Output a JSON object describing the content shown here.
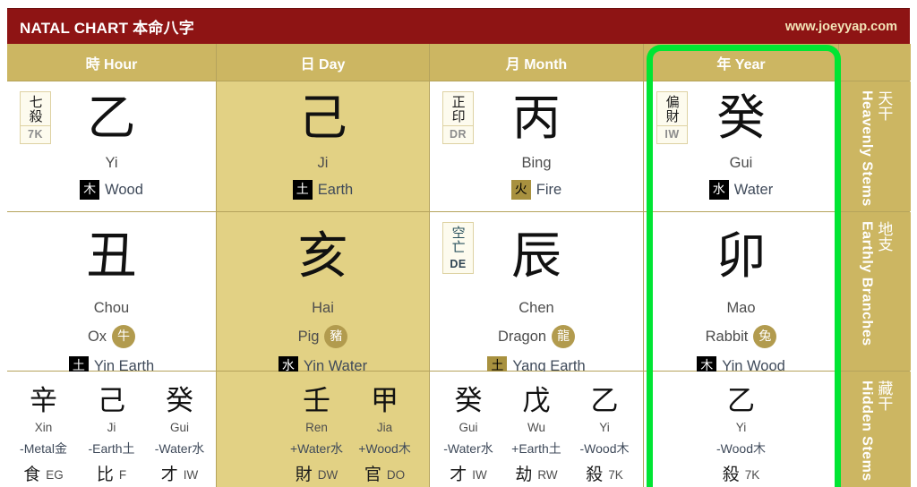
{
  "header": {
    "title": "NATAL CHART 本命八字",
    "website": "www.joeyyap.com",
    "bar_color": "#8e1414",
    "accent_color": "#ccb662",
    "highlight_color": "#00e533"
  },
  "columns": [
    {
      "key": "hour",
      "label": "時 Hour",
      "highlighted": false,
      "day_master": false
    },
    {
      "key": "day",
      "label": "日 Day",
      "highlighted": false,
      "day_master": true
    },
    {
      "key": "month",
      "label": "月 Month",
      "highlighted": false,
      "day_master": false
    },
    {
      "key": "year",
      "label": "年 Year",
      "highlighted": true,
      "day_master": false
    }
  ],
  "row_labels": [
    {
      "cn": "天干",
      "en": "Heavenly Stems"
    },
    {
      "cn": "地支",
      "en": "Earthly Branches"
    },
    {
      "cn": "藏干",
      "en": "Hidden Stems"
    }
  ],
  "heavenly_stems": {
    "hour": {
      "badge_cn": "七殺",
      "badge_ab": "7K",
      "badge_style": "gray",
      "char": "乙",
      "romanization": "Yi",
      "element_cn": "木",
      "element_en": "Wood",
      "element_badge_style": "black"
    },
    "day": {
      "badge_cn": "",
      "badge_ab": "",
      "badge_style": "none",
      "char": "己",
      "romanization": "Ji",
      "element_cn": "土",
      "element_en": "Earth",
      "element_badge_style": "black"
    },
    "month": {
      "badge_cn": "正印",
      "badge_ab": "DR",
      "badge_style": "gray",
      "char": "丙",
      "romanization": "Bing",
      "element_cn": "火",
      "element_en": "Fire",
      "element_badge_style": "gold"
    },
    "year": {
      "badge_cn": "偏財",
      "badge_ab": "IW",
      "badge_style": "gray",
      "char": "癸",
      "romanization": "Gui",
      "element_cn": "水",
      "element_en": "Water",
      "element_badge_style": "black"
    }
  },
  "earthly_branches": {
    "hour": {
      "badge_cn": "",
      "badge_ab": "",
      "badge_style": "none",
      "char": "丑",
      "romanization": "Chou",
      "animal_en": "Ox",
      "animal_cn": "牛",
      "element_cn": "土",
      "element_en": "Yin Earth",
      "element_badge_style": "black"
    },
    "day": {
      "badge_cn": "",
      "badge_ab": "",
      "badge_style": "none",
      "char": "亥",
      "romanization": "Hai",
      "animal_en": "Pig",
      "animal_cn": "豬",
      "element_cn": "水",
      "element_en": "Yin Water",
      "element_badge_style": "black"
    },
    "month": {
      "badge_cn": "空亡",
      "badge_ab": "DE",
      "badge_style": "teal",
      "char": "辰",
      "romanization": "Chen",
      "animal_en": "Dragon",
      "animal_cn": "龍",
      "element_cn": "土",
      "element_en": "Yang Earth",
      "element_badge_style": "gold"
    },
    "year": {
      "badge_cn": "",
      "badge_ab": "",
      "badge_style": "none",
      "char": "卯",
      "romanization": "Mao",
      "animal_en": "Rabbit",
      "animal_cn": "兔",
      "element_cn": "木",
      "element_en": "Yin Wood",
      "element_badge_style": "black"
    }
  },
  "hidden_stems": {
    "hour": [
      {
        "char": "辛",
        "romanization": "Xin",
        "element": "-Metal金",
        "god_cn": "食",
        "god_ab": "EG"
      },
      {
        "char": "己",
        "romanization": "Ji",
        "element": "-Earth土",
        "god_cn": "比",
        "god_ab": "F"
      },
      {
        "char": "癸",
        "romanization": "Gui",
        "element": "-Water水",
        "god_cn": "才",
        "god_ab": "IW"
      }
    ],
    "day": [
      {
        "char": "壬",
        "romanization": "Ren",
        "element": "+Water水",
        "god_cn": "財",
        "god_ab": "DW"
      },
      {
        "char": "甲",
        "romanization": "Jia",
        "element": "+Wood木",
        "god_cn": "官",
        "god_ab": "DO"
      }
    ],
    "month": [
      {
        "char": "癸",
        "romanization": "Gui",
        "element": "-Water水",
        "god_cn": "才",
        "god_ab": "IW"
      },
      {
        "char": "戊",
        "romanization": "Wu",
        "element": "+Earth土",
        "god_cn": "劫",
        "god_ab": "RW"
      },
      {
        "char": "乙",
        "romanization": "Yi",
        "element": "-Wood木",
        "god_cn": "殺",
        "god_ab": "7K"
      }
    ],
    "year": [
      {
        "char": "乙",
        "romanization": "Yi",
        "element": "-Wood木",
        "god_cn": "殺",
        "god_ab": "7K"
      }
    ]
  }
}
